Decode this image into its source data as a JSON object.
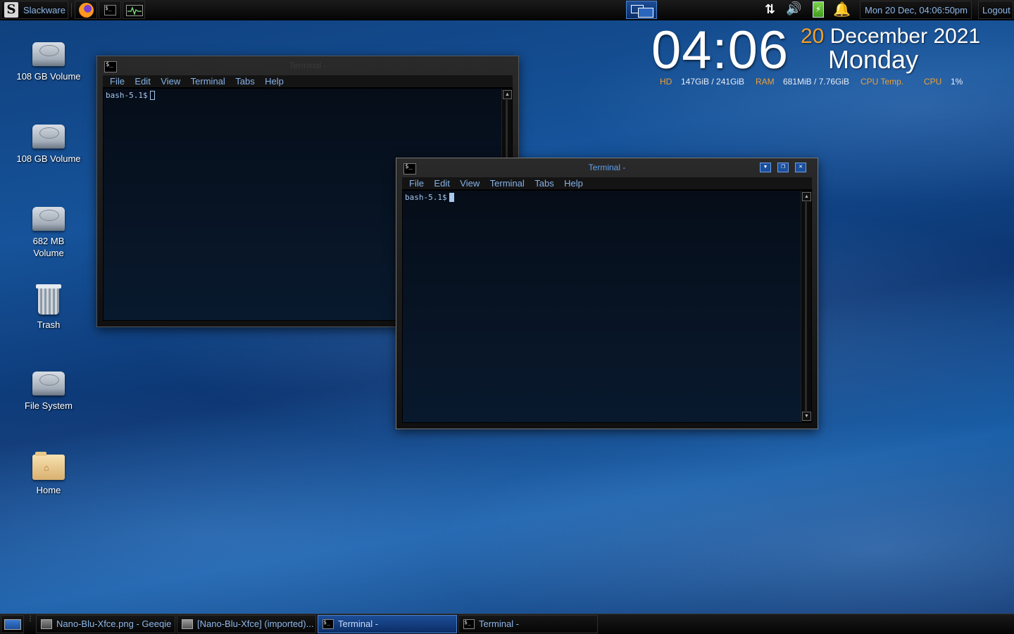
{
  "top_panel": {
    "menu_label": "Slackware",
    "clock": "Mon 20 Dec, 04:06:50pm",
    "logout_label": "Logout"
  },
  "desktop_icons": [
    {
      "label": "108 GB Volume",
      "icon": "drive-icon"
    },
    {
      "label": "108 GB Volume",
      "icon": "drive-icon"
    },
    {
      "label": "682 MB Volume",
      "icon": "drive-icon"
    },
    {
      "label": "Trash",
      "icon": "trash-icon"
    },
    {
      "label": "File System",
      "icon": "drive-icon"
    },
    {
      "label": "Home",
      "icon": "home-folder-icon"
    }
  ],
  "widget": {
    "time": "04:06",
    "day": "20",
    "month_year": "December 2021",
    "weekday": "Monday",
    "hd_label": "HD",
    "hd_value": "147GiB / 241GiB",
    "ram_label": "RAM",
    "ram_value": "681MiB / 7.76GiB",
    "cputemp_label": "CPU Temp.",
    "cpu_label": "CPU",
    "cpu_value": "1%"
  },
  "terminal_back": {
    "title": "Terminal -",
    "menu": [
      "File",
      "Edit",
      "View",
      "Terminal",
      "Tabs",
      "Help"
    ],
    "prompt": "bash-5.1$"
  },
  "terminal_front": {
    "title": "Terminal -",
    "menu": [
      "File",
      "Edit",
      "View",
      "Terminal",
      "Tabs",
      "Help"
    ],
    "prompt": "bash-5.1$"
  },
  "taskbar": {
    "tasks": [
      {
        "label": "Nano-Blu-Xfce.png - Geeqie"
      },
      {
        "label": "[Nano-Blu-Xfce] (imported)..."
      },
      {
        "label": "Terminal -"
      },
      {
        "label": "Terminal -"
      }
    ]
  },
  "colors": {
    "accent": "#8db7ea",
    "orange": "#f0a030",
    "active_task": "#1d4e98"
  }
}
